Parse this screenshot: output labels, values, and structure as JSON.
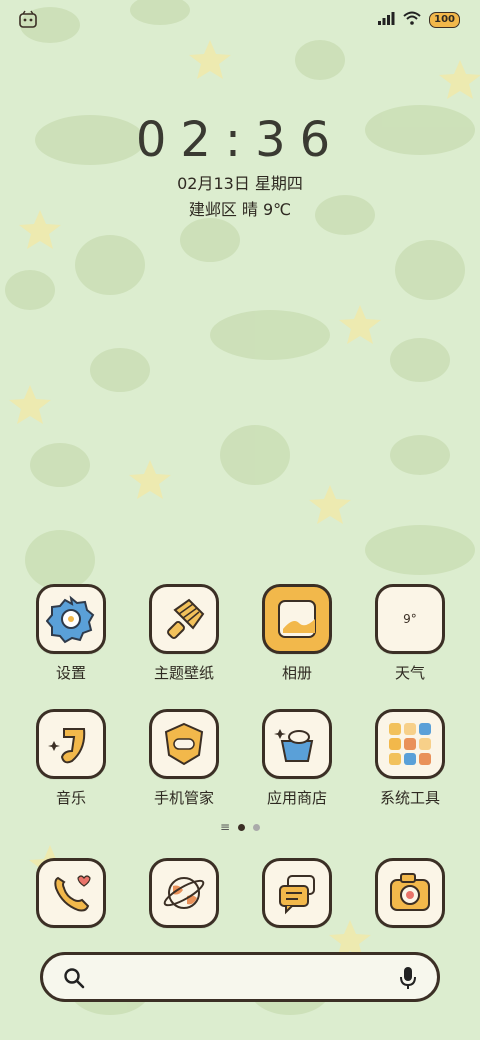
{
  "status": {
    "battery_text": "100"
  },
  "lockscreen": {
    "time": "02:36",
    "date": "02月13日 星期四",
    "weather": "建邺区 晴 9℃"
  },
  "apps": [
    {
      "name": "设置"
    },
    {
      "name": "主题壁纸"
    },
    {
      "name": "相册"
    },
    {
      "name": "天气"
    },
    {
      "name": "音乐"
    },
    {
      "name": "手机管家"
    },
    {
      "name": "应用商店"
    },
    {
      "name": "系统工具"
    }
  ],
  "weather_tile_text": "9°",
  "page_indicator": {
    "current": 2,
    "total": 3
  },
  "dock": [
    {
      "icon": "phone-icon"
    },
    {
      "icon": "browser-icon"
    },
    {
      "icon": "messages-icon"
    },
    {
      "icon": "camera-icon"
    }
  ],
  "colors": {
    "background": "#dcedcf",
    "tile_border": "#3b2f25",
    "tile_fill": "#fbf5e7",
    "accent_orange": "#f2b84b",
    "accent_blue": "#5aa0d8"
  }
}
